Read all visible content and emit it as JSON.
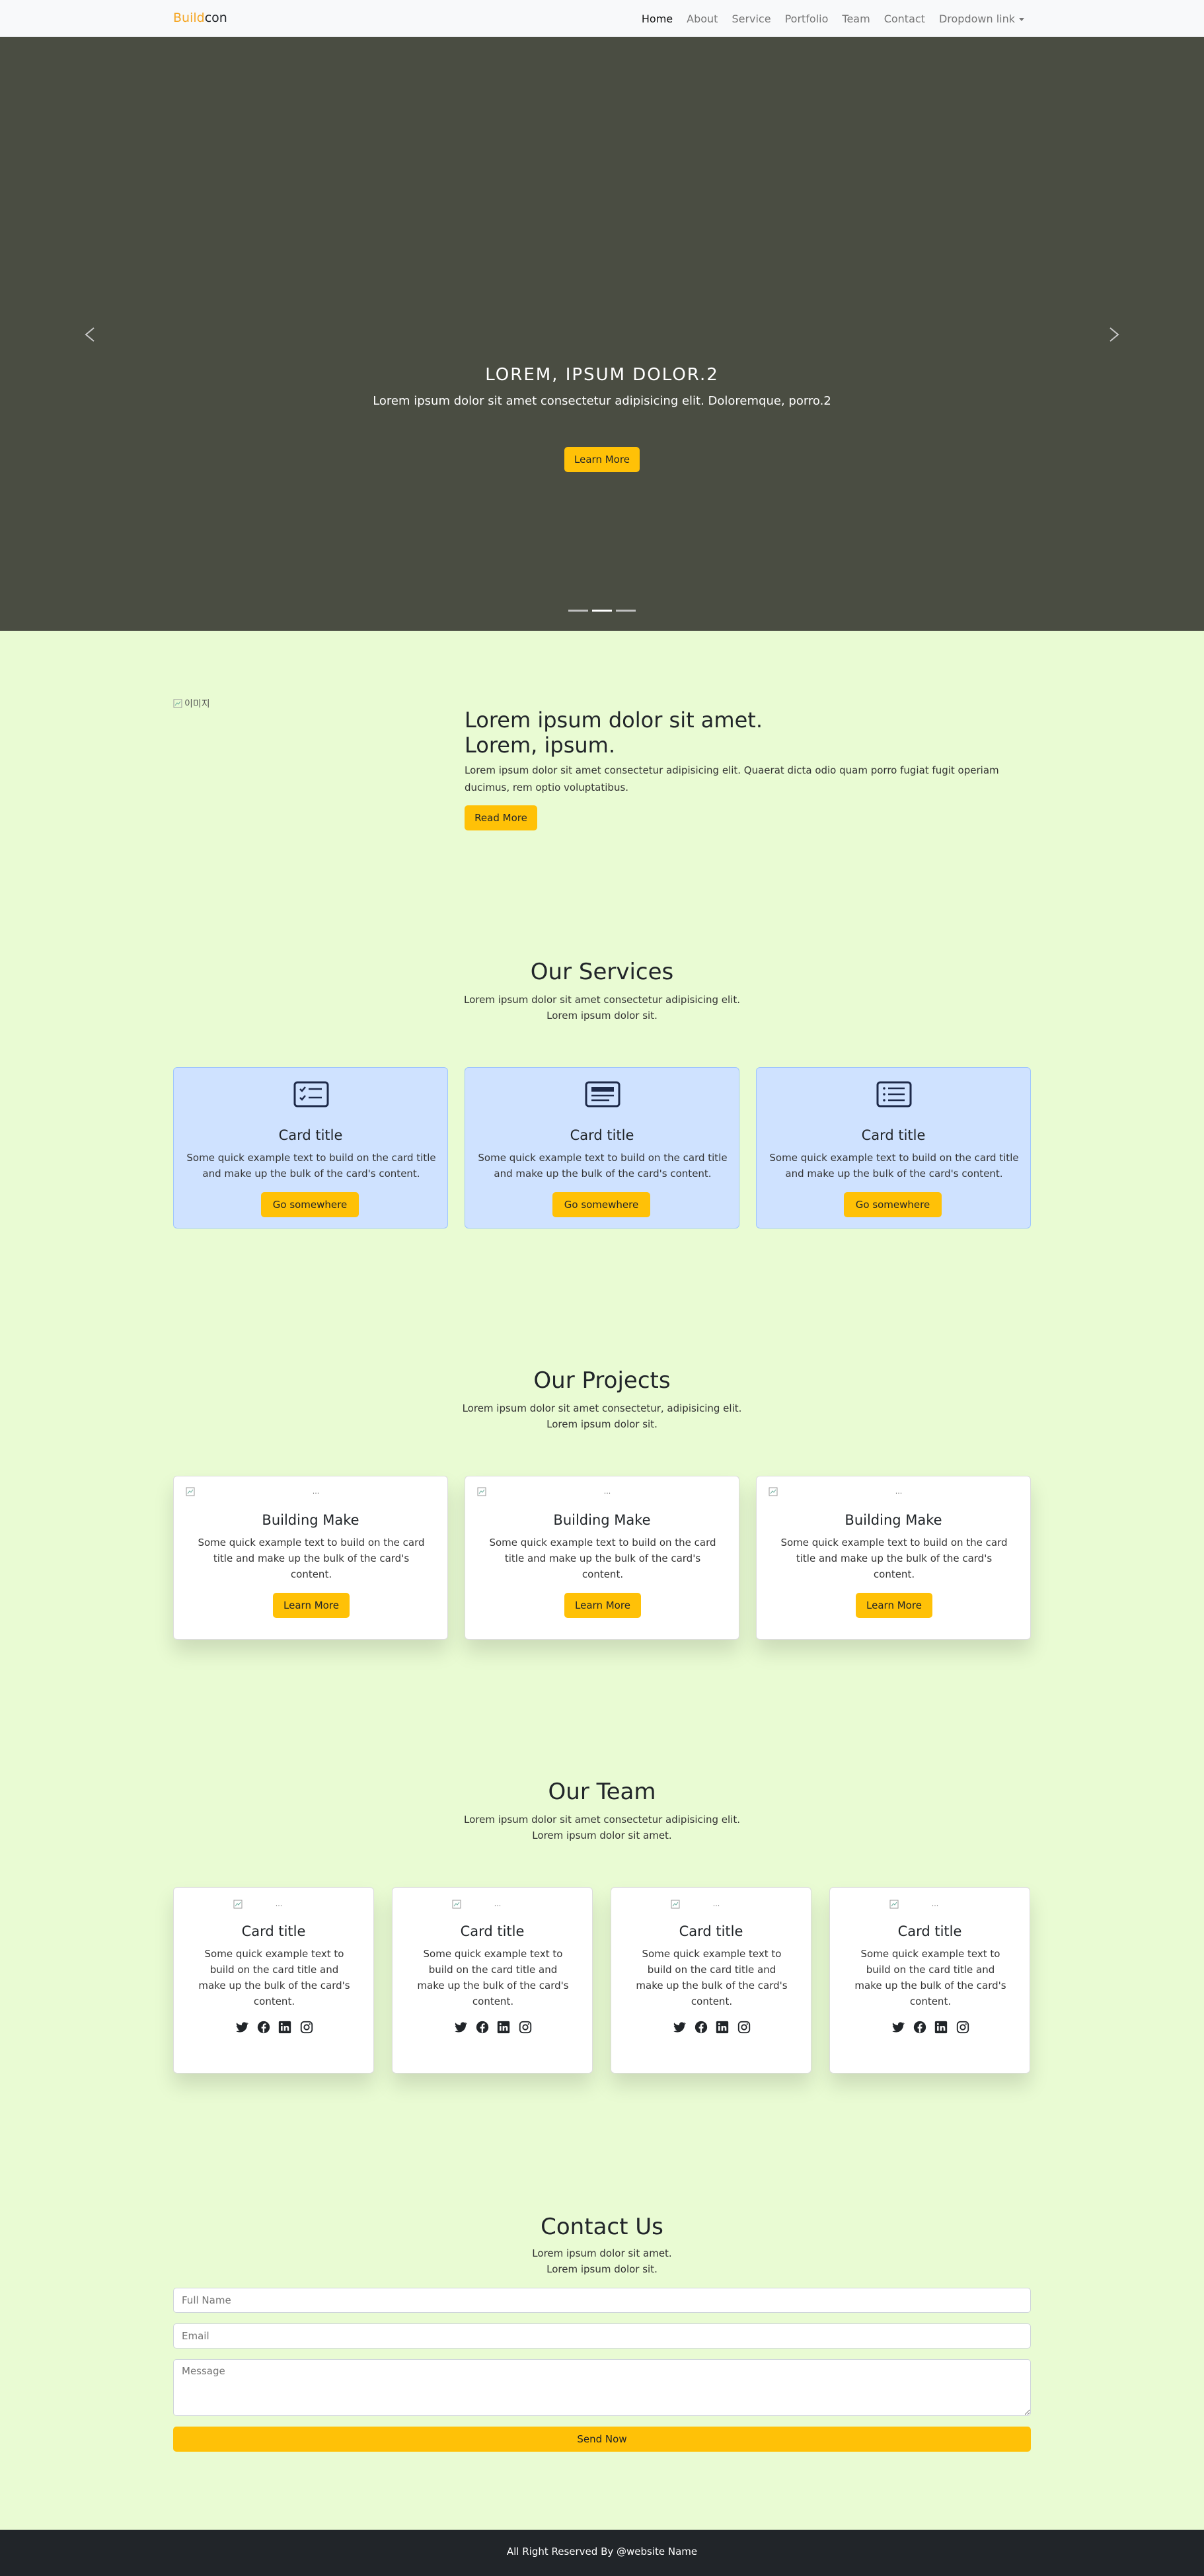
{
  "nav": {
    "brand_part1": "Build",
    "brand_part2": "con",
    "items": [
      {
        "label": "Home"
      },
      {
        "label": "About"
      },
      {
        "label": "Service"
      },
      {
        "label": "Portfolio"
      },
      {
        "label": "Team"
      },
      {
        "label": "Contact"
      },
      {
        "label": "Dropdown link"
      }
    ]
  },
  "hero": {
    "title": "LOREM, IPSUM DOLOR.2",
    "subtitle": "Lorem ipsum dolor sit amet consectetur adipisicing elit. Doloremque, porro.2",
    "button": "Learn More",
    "slides": 3,
    "active_slide": 2,
    "prev_icon": "chevron-left-icon",
    "next_icon": "chevron-right-icon"
  },
  "about": {
    "image_alt": "이미지",
    "title_line1": "Lorem ipsum dolor sit amet.",
    "title_line2": "Lorem, ipsum.",
    "text": "Lorem ipsum dolor sit amet consectetur adipisicing elit. Quaerat dicta odio quam porro fugiat fugit operiam ducimus, rem optio voluptatibus.",
    "button": "Read More"
  },
  "services": {
    "title": "Our Services",
    "sub_line1": "Lorem ipsum dolor sit amet consectetur adipisicing elit.",
    "sub_line2": "Lorem ipsum dolor sit.",
    "cards": [
      {
        "icon": "card-checklist-icon",
        "title": "Card title",
        "text": "Some quick example text to build on the card title and make up the bulk of the card's content.",
        "button": "Go somewhere"
      },
      {
        "icon": "card-text-icon",
        "title": "Card title",
        "text": "Some quick example text to build on the card title and make up the bulk of the card's content.",
        "button": "Go somewhere"
      },
      {
        "icon": "card-list-icon",
        "title": "Card title",
        "text": "Some quick example text to build on the card title and make up the bulk of the card's content.",
        "button": "Go somewhere"
      }
    ]
  },
  "projects": {
    "title": "Our Projects",
    "sub_line1": "Lorem ipsum dolor sit amet consectetur, adipisicing elit.",
    "sub_line2": "Lorem ipsum dolor sit.",
    "image_alt": "...",
    "cards": [
      {
        "title": "Building Make",
        "text": "Some quick example text to build on the card title and make up the bulk of the card's content.",
        "button": "Learn More"
      },
      {
        "title": "Building Make",
        "text": "Some quick example text to build on the card title and make up the bulk of the card's content.",
        "button": "Learn More"
      },
      {
        "title": "Building Make",
        "text": "Some quick example text to build on the card title and make up the bulk of the card's content.",
        "button": "Learn More"
      }
    ]
  },
  "team": {
    "title": "Our Team",
    "sub_line1": "Lorem ipsum dolor sit amet consectetur adipisicing elit.",
    "sub_line2": "Lorem ipsum dolor sit amet.",
    "image_alt": "...",
    "social_icons": [
      "twitter-icon",
      "facebook-icon",
      "linkedin-icon",
      "instagram-icon"
    ],
    "cards": [
      {
        "title": "Card title",
        "text": "Some quick example text to build on the card title and make up the bulk of the card's content."
      },
      {
        "title": "Card title",
        "text": "Some quick example text to build on the card title and make up the bulk of the card's content."
      },
      {
        "title": "Card title",
        "text": "Some quick example text to build on the card title and make up the bulk of the card's content."
      },
      {
        "title": "Card title",
        "text": "Some quick example text to build on the card title and make up the bulk of the card's content."
      }
    ]
  },
  "contact": {
    "title": "Contact Us",
    "sub_line1": "Lorem ipsum dolor sit amet.",
    "sub_line2": "Lorem ipsum dolor sit.",
    "name_placeholder": "Full Name",
    "email_placeholder": "Email",
    "message_placeholder": "Message",
    "button": "Send Now"
  },
  "footer": {
    "text": "All Right Reserved By @website Name"
  },
  "colors": {
    "accent": "#ffc107",
    "brand": "#f5a623",
    "page_bg": "#e9fbd3",
    "hero_bg": "#4a4d42",
    "service_card_bg": "#cfe2ff",
    "footer_bg": "#212529"
  }
}
